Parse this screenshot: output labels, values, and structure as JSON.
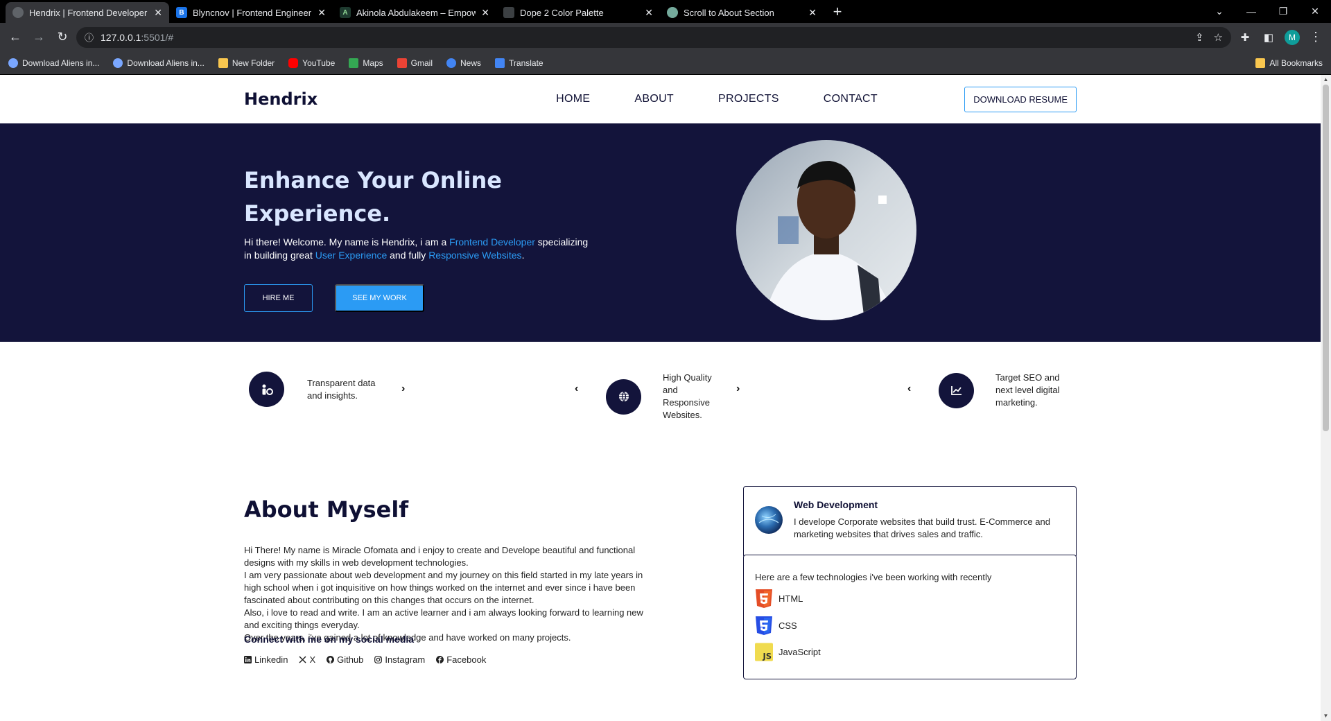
{
  "browser": {
    "tabs": [
      {
        "title": "Hendrix | Frontend Developer",
        "active": true,
        "favicon_color": "#5f6368"
      },
      {
        "title": "Blyncnov | Frontend Engineer",
        "active": false,
        "favicon_color": "#1a73e8"
      },
      {
        "title": "Akinola Abdulakeem – Empower",
        "active": false,
        "favicon_color": "#1e3a2f"
      },
      {
        "title": "Dope 2 Color Palette",
        "active": false,
        "favicon_color": "#3c4043"
      },
      {
        "title": "Scroll to About Section",
        "active": false,
        "favicon_color": "#74aa9c"
      }
    ],
    "url_host": "127.0.0.1",
    "url_rest": ":5501/#",
    "profile_initial": "M",
    "bookmarks": [
      {
        "label": "Download Aliens in...",
        "icon": "app-icon",
        "color": "#7aa7ff"
      },
      {
        "label": "Download Aliens in...",
        "icon": "app-icon",
        "color": "#7aa7ff"
      },
      {
        "label": "New Folder",
        "icon": "folder-icon",
        "color": "#f9c74f"
      },
      {
        "label": "YouTube",
        "icon": "youtube-icon",
        "color": "#ff0000"
      },
      {
        "label": "Maps",
        "icon": "maps-icon",
        "color": "#34a853"
      },
      {
        "label": "Gmail",
        "icon": "gmail-icon",
        "color": "#ea4335"
      },
      {
        "label": "News",
        "icon": "news-icon",
        "color": "#4285f4"
      },
      {
        "label": "Translate",
        "icon": "translate-icon",
        "color": "#4285f4"
      }
    ],
    "all_bookmarks": "All Bookmarks"
  },
  "nav": {
    "logo": "Hendrix",
    "links": [
      "HOME",
      "ABOUT",
      "PROJECTS",
      "CONTACT"
    ],
    "resume_button": "DOWNLOAD RESUME"
  },
  "hero": {
    "title": "Enhance Your Online Experience.",
    "intro_1": "Hi there! Welcome. My name is Hendrix, i am a ",
    "highlight_1": "Frontend Developer",
    "intro_2": " specializing in building great ",
    "highlight_2": "User Experience",
    "intro_3": " and fully ",
    "highlight_3": "Responsive Websites",
    "intro_4": ".",
    "hire_button": "HIRE ME",
    "work_button": "SEE MY WORK"
  },
  "features": [
    {
      "text": "Transparent data and insights.",
      "icon": "insights-icon"
    },
    {
      "text": "High Quality and Responsive Websites.",
      "icon": "globe-icon"
    },
    {
      "text": "Target SEO and next level digital marketing.",
      "icon": "chart-icon"
    }
  ],
  "about": {
    "title": "About Myself",
    "paragraph_1": "Hi There! My name is Miracle Ofomata and i enjoy to create and Develope beautiful and functional designs with my skills in web development technologies.",
    "paragraph_2": "I am very passionate about web development and my journey on this field started in my late years in high school when i got inquisitive on how things worked on the internet and ever since i have been fascinated about contributing on this changes that occurs on the internet.",
    "paragraph_3": "Also, i love to read and write. I am an active learner and i am always looking forward to learning new and exciting things everyday.",
    "paragraph_4": "Over the years, i've gained a lot of knowledge and have worked on many projects.",
    "connect_heading": "Connect with me on my social media",
    "socials": [
      "Linkedin",
      "X",
      "Github",
      "Instagram",
      "Facebook"
    ]
  },
  "cards": {
    "web_title": "Web Development",
    "web_desc": "I develope Corporate websites that build trust. E-Commerce and marketing websites that drives sales and traffic.",
    "tech_intro": "Here are a few technologies i've been working with recently",
    "techs": [
      {
        "name": "HTML",
        "color": "#e44d26",
        "icon": "html5-icon"
      },
      {
        "name": "CSS",
        "color": "#264de4",
        "icon": "css3-icon"
      },
      {
        "name": "JavaScript",
        "color": "#f0db4f",
        "icon": "javascript-icon"
      }
    ]
  }
}
